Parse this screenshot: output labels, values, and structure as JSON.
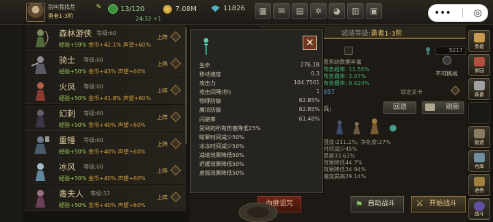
{
  "player": {
    "name": "别叫我找茬",
    "title": "勇者1-3阶"
  },
  "resources": {
    "stamina": "13/120",
    "timer": "24:32 +1",
    "gold": "7.08M",
    "gems": "11826"
  },
  "toolbar_icons": [
    "shop-icon",
    "mail-icon",
    "gift-icon",
    "settings-icon",
    "color-icon",
    "calendar-icon",
    "treasure-icon"
  ],
  "mini_program": {
    "menu": "•••",
    "close": "◎"
  },
  "heroes": [
    {
      "name": "森林游侠",
      "level": "等级:60",
      "exp": "经验+59%",
      "gold": "金币+42.1%",
      "rep": "声望+60%",
      "status": "上阵"
    },
    {
      "name": "骑士",
      "level": "等级:60",
      "exp": "经验+50%",
      "gold": "金币+43%",
      "rep": "声望+60%",
      "status": "上阵"
    },
    {
      "name": "火凤",
      "level": "等级:60",
      "exp": "经验+50%",
      "gold": "金币+41.8%",
      "rep": "声望+60%",
      "status": "上阵"
    },
    {
      "name": "幻刺",
      "level": "等级:60",
      "exp": "经验+50%",
      "gold": "金币+40%",
      "rep": "声望+60%",
      "status": "上阵"
    },
    {
      "name": "重锤",
      "level": "等级:60",
      "exp": "经验+50%",
      "gold": "金币+40%",
      "rep": "声望+60%",
      "status": "上阵"
    },
    {
      "name": "冰风",
      "level": "等级:60",
      "exp": "经验+50%",
      "gold": "金币+40%",
      "rep": "声望+60%",
      "status": "上阵"
    },
    {
      "name": "毒夫人",
      "level": "等级:32",
      "exp": "经验+50%",
      "gold": "金币+40%",
      "rep": "声望+60%",
      "status": "上阵"
    }
  ],
  "city": {
    "label": "城墙等级:",
    "value": "勇者1-3阶"
  },
  "right_panel": {
    "number": "5217",
    "line1": "意系统数据丰富",
    "line2": "布条概率: 11.56%",
    "line3": "布条概率: 2.07%",
    "line4": "布条概率: 0.024%",
    "badge": "不可挑战",
    "count": "957",
    "lock_label": "锁定关卡",
    "retreat": "回退",
    "refresh": "刷新",
    "stats_lines": [
      "强度:211.2%, 净化度:27%",
      "时间减少45%",
      "提高33.63%",
      "效果降低44.7%",
      "效果降低34.94%",
      "速度提高29.14%"
    ]
  },
  "side_nav": [
    {
      "label": "英雄",
      "color": "#c89a50"
    },
    {
      "label": "家园",
      "color": "#b05040"
    },
    {
      "label": "装备",
      "color": "#a0a0a0"
    },
    {
      "label": "锻造",
      "color": "#8a7a60"
    },
    {
      "label": "仓库",
      "color": "#7090a0"
    },
    {
      "label": "酒券",
      "color": "#a08040"
    },
    {
      "label": "公会",
      "color": "#a05060"
    },
    {
      "label": "战斗",
      "color": "#6050a0"
    }
  ],
  "buttons": {
    "curse": "血继诅咒",
    "auto": "自动战斗",
    "fight": "开始战斗"
  },
  "item_modal": {
    "close": "✕",
    "attributes": [
      {
        "label": "生命",
        "value": "276.1B"
      },
      {
        "label": "移动速度",
        "value": "0.3"
      },
      {
        "label": "攻击力",
        "value": "104.7501"
      },
      {
        "label": "攻击间隔(秒)",
        "value": "1"
      },
      {
        "label": "物理防御",
        "value": "82.85%"
      },
      {
        "label": "魔法防御",
        "value": "82.85%"
      },
      {
        "label": "闪避率",
        "value": "61.48%"
      },
      {
        "label": "受到的所有伤害降低25%",
        "value": ""
      },
      {
        "label": "眩晕时间减少50%",
        "value": ""
      },
      {
        "label": "冰冻时间减少50%",
        "value": ""
      },
      {
        "label": "减速效果降低50%",
        "value": ""
      },
      {
        "label": "迟缓效果降低50%",
        "value": ""
      },
      {
        "label": "虚弱效果降低50%",
        "value": ""
      }
    ]
  }
}
